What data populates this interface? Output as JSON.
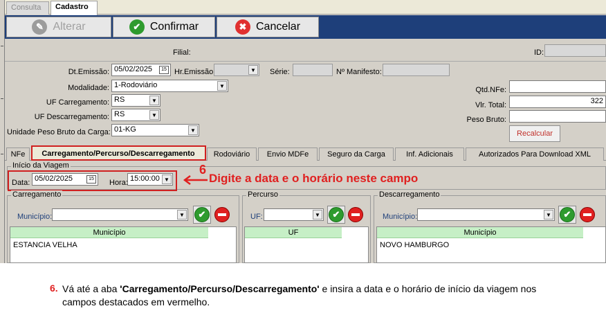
{
  "top_tabs": [
    {
      "label": "Consulta"
    },
    {
      "label": "Cadastro"
    }
  ],
  "toolbar": {
    "alterar_label": "Alterar",
    "confirmar_label": "Confirmar",
    "cancelar_label": "Cancelar"
  },
  "header": {
    "filial_label": "Filial:",
    "id_label": "ID:",
    "id_value": "",
    "dt_emissao_label": "Dt.Emissão:",
    "dt_emissao_value": "05/02/2025",
    "hr_emissao_label": "Hr.Emissão:",
    "hr_emissao_value": "",
    "serie_label": "Série:",
    "serie_value": "",
    "manifesto_label": "Nº Manifesto:",
    "manifesto_value": "",
    "modalidade_label": "Modalidade:",
    "modalidade_value": "1-Rodoviário",
    "uf_carregamento_label": "UF Carregamento:",
    "uf_carregamento_value": "RS",
    "uf_descarregamento_label": "UF Descarregamento:",
    "uf_descarregamento_value": "RS",
    "unidade_peso_label": "Unidade Peso Bruto da Carga:",
    "unidade_peso_value": "01-KG",
    "qtd_nfe_label": "Qtd.NFe:",
    "qtd_nfe_value": "",
    "vlr_total_label": "Vlr. Total:",
    "vlr_total_value": "322",
    "peso_bruto_label": "Peso Bruto:",
    "peso_bruto_value": "",
    "recalcular_label": "Recalcular"
  },
  "sub_tabs": [
    {
      "label": "NFe"
    },
    {
      "label": "Carregamento/Percurso/Descarregamento"
    },
    {
      "label": "Rodoviário"
    },
    {
      "label": "Envio MDFe"
    },
    {
      "label": "Seguro da Carga"
    },
    {
      "label": "Inf. Adicionais"
    },
    {
      "label": "Autorizados Para Download XML"
    }
  ],
  "inicio_viagem": {
    "group_label": "Início da Viagem",
    "data_label": "Data:",
    "data_value": "05/02/2025",
    "hora_label": "Hora:",
    "hora_value": "15:00:00"
  },
  "annotation": {
    "step_number": "6",
    "text": "Digite a data e o horário neste campo"
  },
  "carregamento": {
    "group_label": "Carregamento",
    "municipio_label": "Município:",
    "municipio_value": "",
    "column_header": "Município",
    "rows": [
      "ESTANCIA VELHA"
    ]
  },
  "percurso": {
    "group_label": "Percurso",
    "uf_label": "UF:",
    "uf_value": "",
    "column_header": "UF",
    "rows": []
  },
  "descarregamento": {
    "group_label": "Descarregamento",
    "municipio_label": "Município:",
    "municipio_value": "",
    "column_header": "Município",
    "rows": [
      "NOVO HAMBURGO"
    ]
  },
  "footer": {
    "step_number": "6.",
    "text_before": "Vá até a aba ",
    "text_bold": "'Carregamento/Percurso/Descarregamento'",
    "text_after": " e insira a data e o horário de início da viagem nos campos destacados em vermelho."
  },
  "colors": {
    "toolbar_bg": "#1e3f7a",
    "annotation_red": "#e02020",
    "grid_header_green": "#c6efc6",
    "confirm_green": "#2e9b2e"
  },
  "icons": {
    "alterar": "pencil-icon",
    "confirmar": "check-icon",
    "cancelar": "close-icon",
    "calendar": "calendar-icon",
    "dropdown": "chevron-down-icon",
    "add": "check-icon",
    "remove": "minus-icon"
  }
}
